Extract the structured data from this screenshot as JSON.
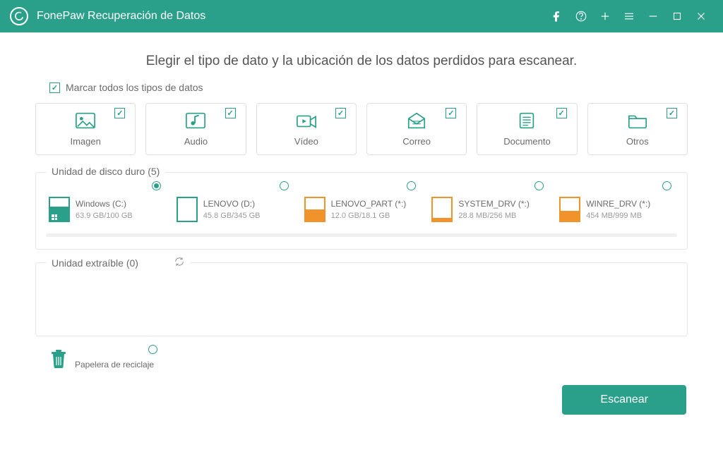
{
  "app": {
    "title": "FonePaw Recuperación de Datos"
  },
  "heading": "Elegir el tipo de dato y la ubicación de los datos perdidos para escanear.",
  "checkAllLabel": "Marcar todos los tipos de datos",
  "types": {
    "image": "Imagen",
    "audio": "Audio",
    "video": "Vídeo",
    "mail": "Correo",
    "document": "Documento",
    "others": "Otros"
  },
  "sections": {
    "hdd": "Unidad de disco duro (5)",
    "ext": "Unidad extraíble (0)"
  },
  "drives": [
    {
      "name": "Windows (C:)",
      "size": "63.9 GB/100 GB",
      "color": "teal",
      "fill": 64,
      "selected": true,
      "win": true
    },
    {
      "name": "LENOVO (D:)",
      "size": "45.8 GB/345 GB",
      "color": "teal",
      "fill": 0,
      "selected": false,
      "win": false
    },
    {
      "name": "LENOVO_PART (*:)",
      "size": "12.0 GB/18.1 GB",
      "color": "orange",
      "fill": 50,
      "selected": false,
      "win": false
    },
    {
      "name": "SYSTEM_DRV (*:)",
      "size": "28.8 MB/256 MB",
      "color": "orange",
      "fill": 11,
      "selected": false,
      "win": false
    },
    {
      "name": "WINRE_DRV (*:)",
      "size": "454 MB/999 MB",
      "color": "orange",
      "fill": 45,
      "selected": false,
      "win": false
    }
  ],
  "recycle": {
    "label": "Papelera de reciclaje"
  },
  "scanBtn": "Escanear"
}
